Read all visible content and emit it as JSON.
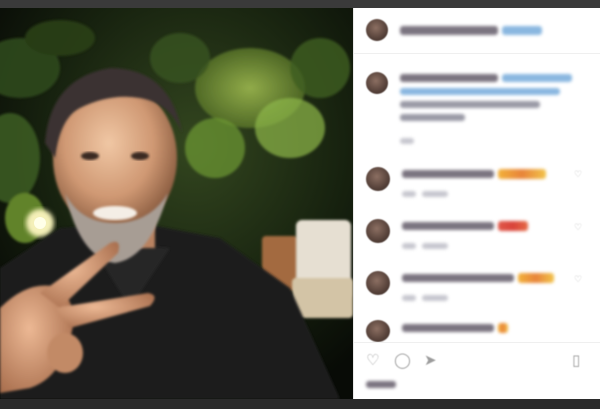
{
  "post": {
    "author": "",
    "location": "",
    "caption": "",
    "comment_count_label": ""
  },
  "comments": [
    {
      "user": "",
      "text": "",
      "time": "",
      "reply_label": ""
    },
    {
      "user": "",
      "text": "",
      "time": "",
      "reply_label": ""
    },
    {
      "user": "",
      "text": "",
      "time": "",
      "reply_label": ""
    },
    {
      "user": "",
      "text": "",
      "time": "",
      "reply_label": ""
    }
  ],
  "actions": {
    "like": "heart-icon",
    "comment": "comment-icon",
    "share": "share-icon",
    "save": "bookmark-icon"
  },
  "likes_label": "",
  "colors": {
    "photo_bg": "#0f140c",
    "sidebar_bg": "#ffffff",
    "frame": "#303030"
  }
}
